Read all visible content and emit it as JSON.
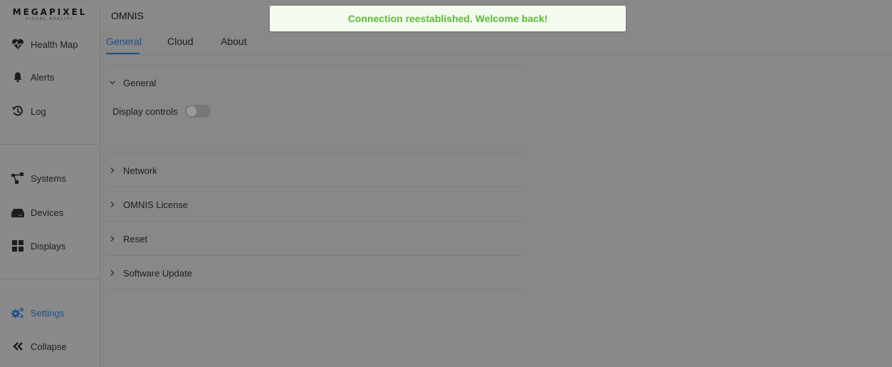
{
  "logo": {
    "main": "MEGAPIXEL",
    "sub": "VISUAL REALITY"
  },
  "header": {
    "title": "OMNIS"
  },
  "toast": {
    "message": "Connection reestablished. Welcome back!"
  },
  "sidebar": {
    "items": [
      {
        "label": "Health Map",
        "icon": "heart-pulse-icon"
      },
      {
        "label": "Alerts",
        "icon": "bell-icon"
      },
      {
        "label": "Log",
        "icon": "history-icon"
      },
      {
        "label": "Systems",
        "icon": "hierarchy-icon"
      },
      {
        "label": "Devices",
        "icon": "device-icon"
      },
      {
        "label": "Displays",
        "icon": "grid-icon"
      },
      {
        "label": "Settings",
        "icon": "gears-icon",
        "active": true
      },
      {
        "label": "Collapse",
        "icon": "double-chevron-left-icon"
      }
    ]
  },
  "tabs": [
    {
      "label": "General",
      "active": true
    },
    {
      "label": "Cloud"
    },
    {
      "label": "About"
    }
  ],
  "sections": {
    "general": {
      "title": "General",
      "expanded": true,
      "display_controls_label": "Display controls",
      "display_controls_on": false
    },
    "network": {
      "title": "Network"
    },
    "license": {
      "title": "OMNIS License"
    },
    "reset": {
      "title": "Reset"
    },
    "software_update": {
      "title": "Software Update"
    }
  },
  "colors": {
    "accent": "#1f4f8a",
    "toast_text": "#5cb93a",
    "toast_bg": "#f4fbef",
    "overlay": "#888888"
  }
}
